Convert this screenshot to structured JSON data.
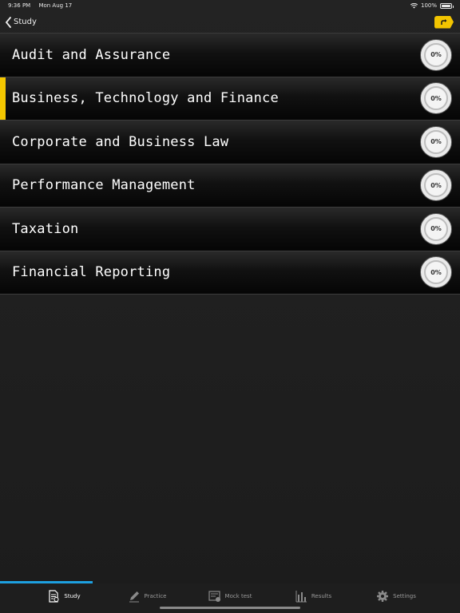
{
  "status": {
    "time": "9:36 PM",
    "date": "Mon Aug 17",
    "battery": "100%"
  },
  "nav": {
    "back_label": "Study",
    "share_color": "#f2c400"
  },
  "subjects": [
    {
      "label": "Audit and Assurance",
      "progress": "0%"
    },
    {
      "label": "Business, Technology and Finance",
      "progress": "0%"
    },
    {
      "label": "Corporate and Business Law",
      "progress": "0%"
    },
    {
      "label": "Performance Management",
      "progress": "0%"
    },
    {
      "label": "Taxation",
      "progress": "0%"
    },
    {
      "label": "Financial Reporting",
      "progress": "0%"
    }
  ],
  "tabs": [
    {
      "label": "Study",
      "icon": "study-icon",
      "active": true
    },
    {
      "label": "Practice",
      "icon": "pencil-icon"
    },
    {
      "label": "Mock test",
      "icon": "mock-test-icon"
    },
    {
      "label": "Results",
      "icon": "bar-chart-icon"
    },
    {
      "label": "Settings",
      "icon": "gear-icon"
    }
  ],
  "colors": {
    "accent": "#f4c700",
    "tab_progress": "#1da0e0"
  }
}
